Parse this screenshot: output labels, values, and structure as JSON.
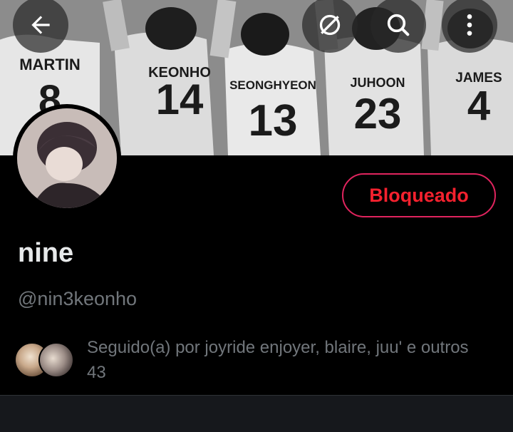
{
  "profile": {
    "display_name": "nine",
    "handle": "@nin3keonho",
    "relationship_button": "Bloqueado",
    "followed_by_text": "Seguido(a) por joyride enjoyer, blaire, juu' e outros 43"
  },
  "banner": {
    "jerseys": [
      {
        "name": "MARTIN",
        "number": "8"
      },
      {
        "name": "KEONHO",
        "number": "14"
      },
      {
        "name": "SEONGHYEON",
        "number": "13"
      },
      {
        "name": "JUHOON",
        "number": "23"
      },
      {
        "name": "JAMES",
        "number": "4"
      }
    ]
  },
  "icons": {
    "back": "arrow-left-icon",
    "explore": "explore-icon",
    "search": "search-icon",
    "more": "more-vertical-icon"
  },
  "colors": {
    "background": "#000000",
    "blocked_red": "#f4212e",
    "secondary_text": "#71767b"
  }
}
